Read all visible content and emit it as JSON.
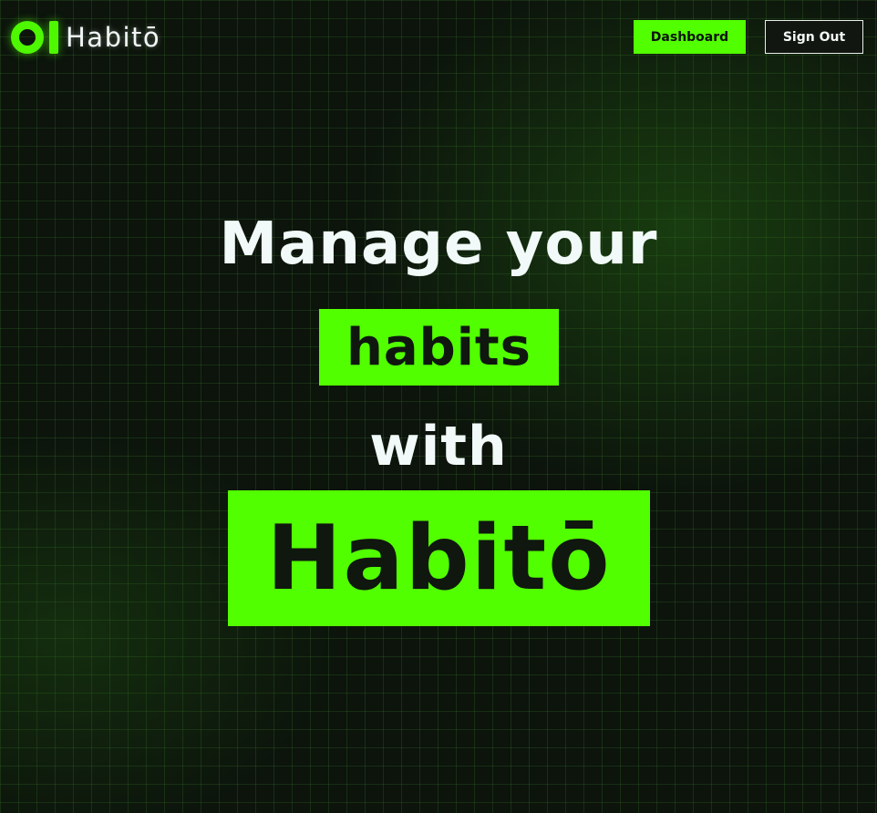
{
  "header": {
    "brand_name": "Habitō",
    "logo_icon": "habito-logo-icon",
    "dashboard_label": "Dashboard",
    "signout_label": "Sign Out"
  },
  "hero": {
    "line1": "Manage your",
    "highlight1": "habits",
    "line3": "with",
    "highlight2": "Habitō"
  },
  "colors": {
    "accent": "#52ff00",
    "background": "#0c140c",
    "text": "#f1faf8"
  }
}
